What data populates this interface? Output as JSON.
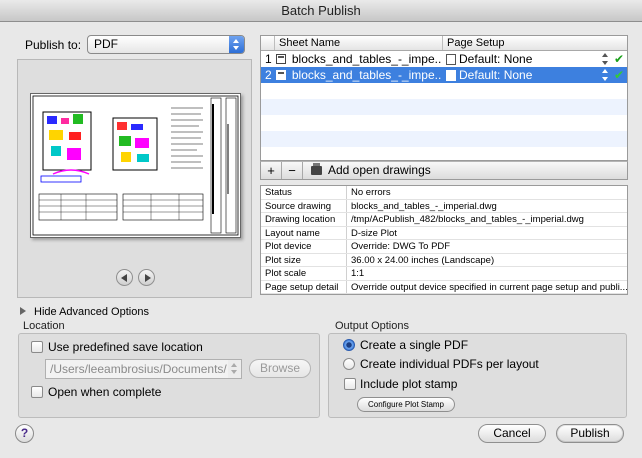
{
  "window": {
    "title": "Batch Publish"
  },
  "publish": {
    "label": "Publish to:",
    "selected": "PDF"
  },
  "sheet_table": {
    "headers": [
      "Sheet Name",
      "Page Setup"
    ],
    "rows": [
      {
        "num": "1",
        "name": "blocks_and_tables_-_impe...",
        "setup": "Default: None",
        "selected": false
      },
      {
        "num": "2",
        "name": "blocks_and_tables_-_impe...",
        "setup": "Default: None",
        "selected": true
      }
    ],
    "add_label": "+",
    "remove_label": "−",
    "add_open_label": "Add open drawings"
  },
  "info": [
    {
      "key": "Status",
      "value": "No errors"
    },
    {
      "key": "Source drawing",
      "value": "blocks_and_tables_-_imperial.dwg"
    },
    {
      "key": "Drawing location",
      "value": "/tmp/AcPublish_482/blocks_and_tables_-_imperial.dwg"
    },
    {
      "key": "Layout name",
      "value": "D-size Plot"
    },
    {
      "key": "Plot device",
      "value": "Override: DWG To PDF"
    },
    {
      "key": "Plot size",
      "value": "36.00 x 24.00 inches (Landscape)"
    },
    {
      "key": "Plot scale",
      "value": "1:1"
    },
    {
      "key": "Page setup detail",
      "value": "Override output device specified in current page setup and publi..."
    }
  ],
  "advanced": {
    "toggle_label": "Hide Advanced Options"
  },
  "location": {
    "title": "Location",
    "use_predefined_label": "Use predefined save location",
    "path": "/Users/leeambrosius/Documents/",
    "browse_label": "Browse",
    "open_when_complete_label": "Open when complete"
  },
  "output": {
    "title": "Output Options",
    "single_pdf_label": "Create a single PDF",
    "individual_pdfs_label": "Create individual PDFs per layout",
    "plot_stamp_label": "Include plot stamp",
    "configure_label": "Configure Plot Stamp"
  },
  "footer": {
    "help_label": "?",
    "cancel_label": "Cancel",
    "publish_label": "Publish"
  },
  "colors": {
    "selection": "#3d80df",
    "check": "#1aa01a",
    "accent": "#2d6ed6"
  }
}
